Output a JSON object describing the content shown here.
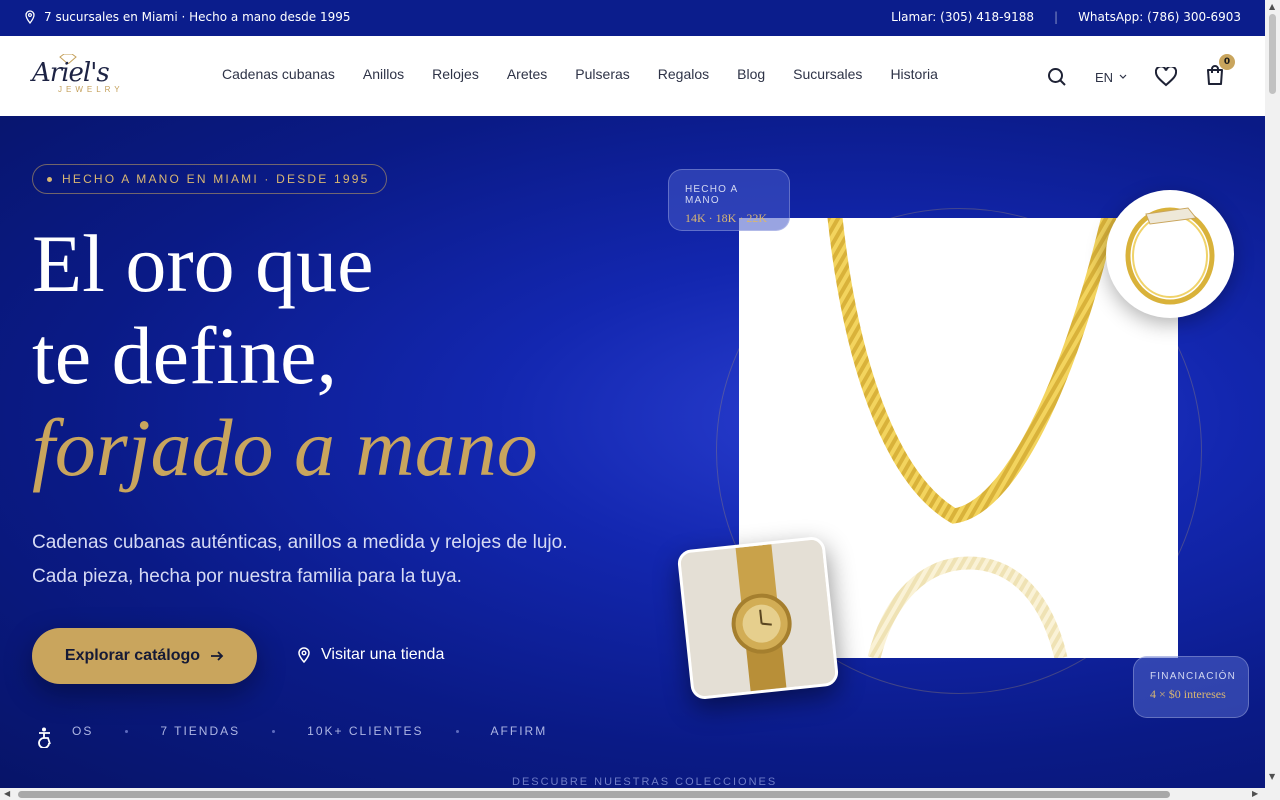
{
  "topbar": {
    "locations": "7 sucursales en Miami · Hecho a mano desde 1995",
    "phone": "Llamar: (305) 418-9188",
    "separator": "|",
    "whatsapp": "WhatsApp: (786) 300-6903"
  },
  "brand": {
    "logo_script": "Ariel's",
    "logo_sub": "JEWELRY"
  },
  "nav": {
    "items": [
      "Cadenas cubanas",
      "Anillos",
      "Relojes",
      "Aretes",
      "Pulseras",
      "Regalos",
      "Blog",
      "Sucursales",
      "Historia"
    ],
    "language": "EN",
    "cart_count": "0"
  },
  "hero": {
    "eyebrow": "HECHO A MANO EN MIAMI · DESDE 1995",
    "title_line1": "El oro que",
    "title_line2": "te define,",
    "title_line3": "forjado a mano",
    "lede": "Cadenas cubanas auténticas, anillos a medida y relojes de lujo. Cada pieza, hecha por nuestra familia para la tuya.",
    "cta_primary": "Explorar catálogo",
    "cta_secondary": "Visitar una tienda",
    "stats": [
      "OS",
      "7 TIENDAS",
      "10K+ CLIENTES",
      "AFFIRM"
    ],
    "discover": "DESCUBRE NUESTRAS COLECCIONES"
  },
  "badges": {
    "top_label": "HECHO A MANO",
    "top_value": "14K · 18K · 22K",
    "bottom_label": "FINANCIACIÓN",
    "bottom_value": "4 × $0 intereses"
  },
  "colors": {
    "brand_blue": "#0b1d8c",
    "gold": "#c9a55d"
  }
}
